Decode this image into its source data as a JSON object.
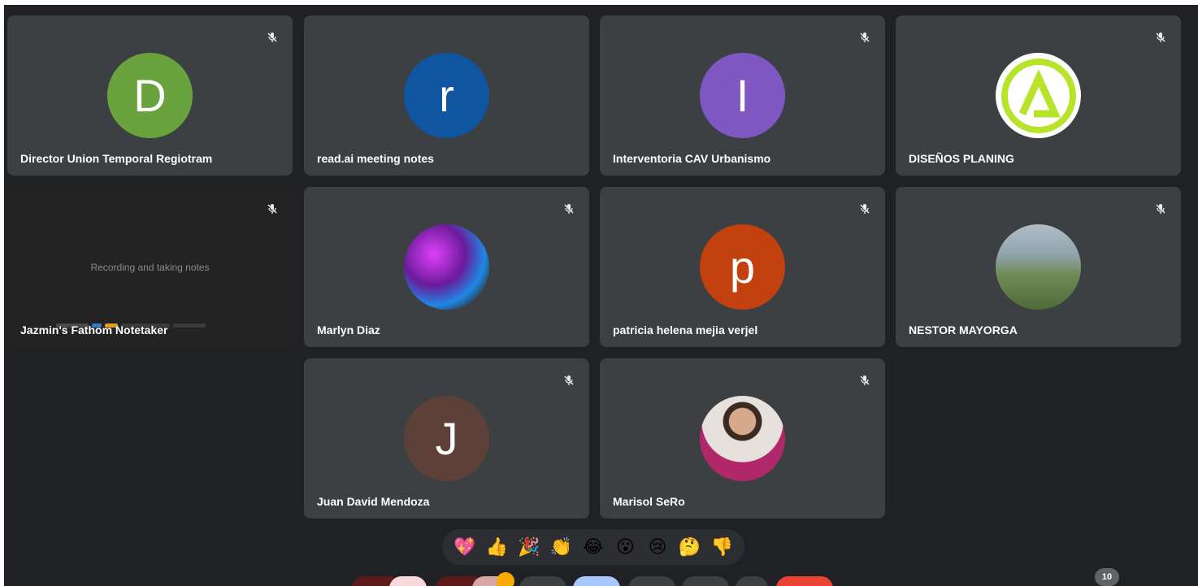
{
  "participants": [
    {
      "name": "Director Union Temporal Regiotram",
      "initial": "D",
      "color": "#6aa33e"
    },
    {
      "name": "read.ai meeting notes",
      "initial": "r",
      "color": "#0f55a0"
    },
    {
      "name": "Interventoria CAV Urbanismo",
      "initial": "I",
      "color": "#7e57c2"
    },
    {
      "name": "DISEÑOS PLANING",
      "initial": "",
      "color": "#ffffff"
    },
    {
      "name": "Jazmin's Fathom Notetaker",
      "status": "Recording and taking notes"
    },
    {
      "name": "Marlyn Diaz",
      "initial": "",
      "color": "#2b2b2b"
    },
    {
      "name": "patricia helena mejia verjel",
      "initial": "p",
      "color": "#c2410e"
    },
    {
      "name": "NESTOR MAYORGA",
      "initial": "",
      "color": "#6f8a55"
    },
    {
      "name": "Juan David Mendoza",
      "initial": "J",
      "color": "#5d4037"
    },
    {
      "name": "Marisol SeRo",
      "initial": "",
      "color": "#e6e1dc"
    }
  ],
  "reactions": [
    "💖",
    "👍",
    "🎉",
    "👏",
    "😂",
    "😮",
    "😢",
    "🤔",
    "👎"
  ],
  "participant_count": "10"
}
